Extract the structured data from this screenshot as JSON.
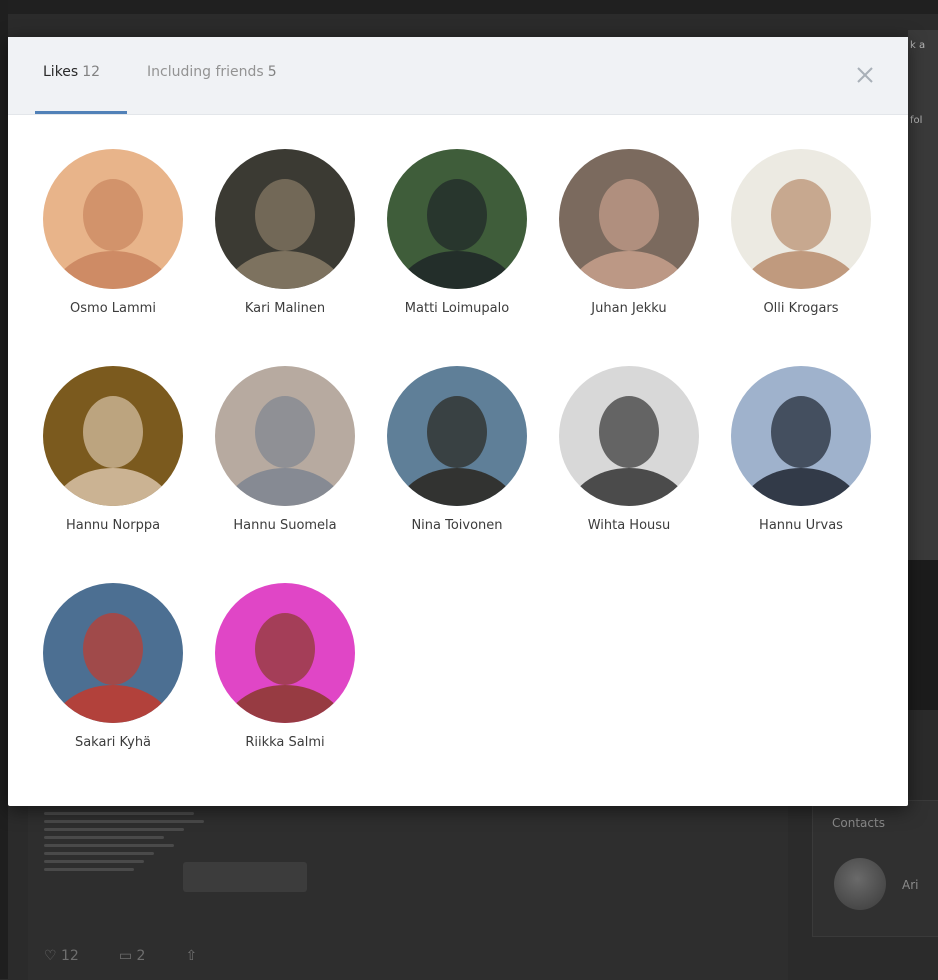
{
  "modal": {
    "tabs": [
      {
        "label": "Likes",
        "count": "12"
      },
      {
        "label": "Including friends",
        "count": "5"
      }
    ],
    "close_symbol": "×"
  },
  "users": [
    {
      "name": "Osmo Lammi",
      "avatar_bg": "#e8b48a",
      "avatar_fg": "#c9845e"
    },
    {
      "name": "Kari Malinen",
      "avatar_bg": "#3b3a33",
      "avatar_fg": "#8a7c67"
    },
    {
      "name": "Matti Loimupalo",
      "avatar_bg": "#3f5d3a",
      "avatar_fg": "#1f2628"
    },
    {
      "name": "Juhan Jekku",
      "avatar_bg": "#7b6a5e",
      "avatar_fg": "#c8a08c"
    },
    {
      "name": "Olli Krogars",
      "avatar_bg": "#eceae2",
      "avatar_fg": "#b88c6c"
    },
    {
      "name": "Hannu Norppa",
      "avatar_bg": "#7b5a1e",
      "avatar_fg": "#d9c3a8"
    },
    {
      "name": "Hannu Suomela",
      "avatar_bg": "#b7aaa0",
      "avatar_fg": "#7e8590"
    },
    {
      "name": "Nina Toivonen",
      "avatar_bg": "#5f7f98",
      "avatar_fg": "#2a261f"
    },
    {
      "name": "Wihta Housu",
      "avatar_bg": "#d8d8d8",
      "avatar_fg": "#333333"
    },
    {
      "name": "Hannu Urvas",
      "avatar_bg": "#9fb2cc",
      "avatar_fg": "#1e2530"
    },
    {
      "name": "Sakari Kyhä",
      "avatar_bg": "#4c6f92",
      "avatar_fg": "#c43a2c"
    },
    {
      "name": "Riikka Salmi",
      "avatar_bg": "#e046c6",
      "avatar_fg": "#8a3a2a"
    }
  ],
  "background": {
    "sidebar_label": "Contacts",
    "sidebar_name": "Ari",
    "like_count": "12",
    "comment_count": "2",
    "right_snippet_1": "k a",
    "right_snippet_2": "fol"
  }
}
